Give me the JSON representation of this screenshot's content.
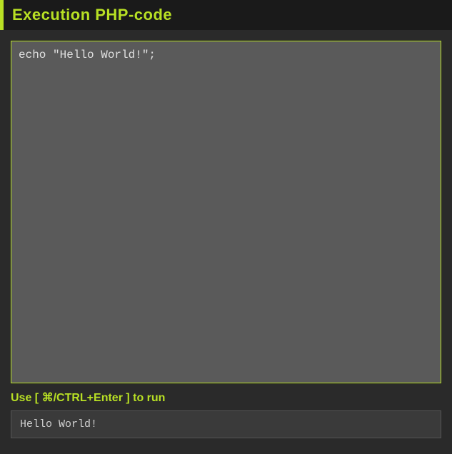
{
  "header": {
    "title": "Execution PHP-code"
  },
  "editor": {
    "code": "echo \"Hello World!\";"
  },
  "hint": {
    "text": "Use [ ⌘/CTRL+Enter ] to run"
  },
  "output": {
    "result": "Hello World!"
  }
}
